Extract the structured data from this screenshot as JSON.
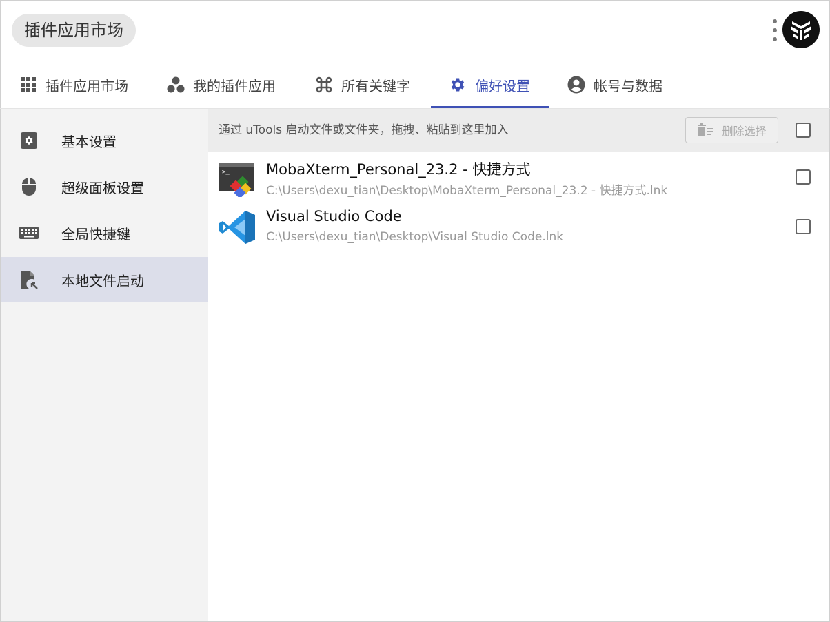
{
  "header": {
    "search_label": "插件应用市场",
    "more_icon": "more-vertical-icon",
    "logo_icon": "utools-logo-icon"
  },
  "tabs": [
    {
      "label": "插件应用市场",
      "icon": "grid-icon"
    },
    {
      "label": "我的插件应用",
      "icon": "plugins-icon"
    },
    {
      "label": "所有关键字",
      "icon": "command-icon"
    },
    {
      "label": "偏好设置",
      "icon": "gear-icon",
      "active": true
    },
    {
      "label": "帐号与数据",
      "icon": "account-icon"
    }
  ],
  "sidebar": {
    "items": [
      {
        "label": "基本设置",
        "icon": "settings-box-icon"
      },
      {
        "label": "超级面板设置",
        "icon": "mouse-icon"
      },
      {
        "label": "全局快捷键",
        "icon": "keyboard-icon"
      },
      {
        "label": "本地文件启动",
        "icon": "file-launch-icon",
        "active": true
      }
    ]
  },
  "toolbar": {
    "hint": "通过 uTools 启动文件或文件夹，拖拽、粘贴到这里加入",
    "delete_label": "删除选择"
  },
  "files": [
    {
      "name": "MobaXterm_Personal_23.2 - 快捷方式",
      "path": "C:\\Users\\dexu_tian\\Desktop\\MobaXterm_Personal_23.2 - 快捷方式.lnk",
      "icon": "mobaxterm-icon"
    },
    {
      "name": "Visual Studio Code",
      "path": "C:\\Users\\dexu_tian\\Desktop\\Visual Studio Code.lnk",
      "icon": "vscode-icon"
    }
  ],
  "colors": {
    "accent": "#3f51b5",
    "sidebar_bg": "#f3f3f3",
    "sidebar_active": "#dcdeea",
    "toolbar_bg": "#ececec"
  }
}
